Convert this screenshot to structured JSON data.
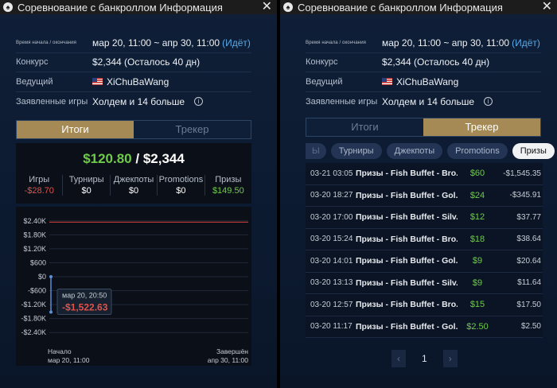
{
  "window_title": "Соревнование с банкроллом Информация",
  "info": {
    "time_label": "Время начала / окончания",
    "time_value": "мар 20, 11:00 ~ апр 30, 11:00",
    "time_status": "(Идёт)",
    "contest_label": "Конкурс",
    "contest_value": "$2,344 (Осталось 40 дн)",
    "host_label": "Ведущий",
    "host_value": "XiChuBaWang",
    "games_label": "Заявленные игры",
    "games_value": "Холдем и 14 больше"
  },
  "tabs": {
    "results": "Итоги",
    "tracker": "Трекер"
  },
  "summary": {
    "current": "$120.80",
    "separator": " / ",
    "target": "$2,344",
    "stats": [
      {
        "label": "Игры",
        "value": "-$28.70",
        "tone": "neg"
      },
      {
        "label": "Турниры",
        "value": "$0",
        "tone": ""
      },
      {
        "label": "Джекпоты",
        "value": "$0",
        "tone": ""
      },
      {
        "label": "Promotions",
        "value": "$0",
        "tone": ""
      },
      {
        "label": "Призы",
        "value": "$149.50",
        "tone": "pos"
      }
    ]
  },
  "chart_data": {
    "type": "line",
    "y_ticks": [
      "$2.40K",
      "$1.80K",
      "$1.20K",
      "$600",
      "$0",
      "-$600",
      "-$1.20K",
      "-$1.80K",
      "-$2.40K"
    ],
    "ylim": [
      -2700,
      2700
    ],
    "target_line": 2344,
    "series": [
      {
        "x": [
          "мар 20, 11:00",
          "мар 20, 20:50"
        ],
        "values": [
          0,
          -1522.63
        ]
      }
    ],
    "start_label": "Начало",
    "start_date": "мар 20, 11:00",
    "end_label": "Завершён",
    "end_date": "апр 30, 11:00",
    "tooltip": {
      "date": "мар 20, 20:50",
      "value": "-$1,522.63"
    },
    "colors": {
      "target": "#c23a3a",
      "line": "#5b8fd6",
      "grid": "#1f2838",
      "axis": "#c7cdd6"
    }
  },
  "filters": [
    "Ы",
    "Турниры",
    "Джекпоты",
    "Promotions",
    "Призы"
  ],
  "transactions": [
    {
      "date": "03-21 03:05",
      "desc": "Призы - Fish Buffet - Bro...",
      "amount": "$60",
      "balance": "-$1,545.35"
    },
    {
      "date": "03-20 18:27",
      "desc": "Призы - Fish Buffet - Gol...",
      "amount": "$24",
      "balance": "-$345.91"
    },
    {
      "date": "03-20 17:00",
      "desc": "Призы - Fish Buffet - Silv...",
      "amount": "$12",
      "balance": "$37.77"
    },
    {
      "date": "03-20 15:24",
      "desc": "Призы - Fish Buffet - Bro...",
      "amount": "$18",
      "balance": "$38.64"
    },
    {
      "date": "03-20 14:01",
      "desc": "Призы - Fish Buffet - Gol...",
      "amount": "$9",
      "balance": "$20.64"
    },
    {
      "date": "03-20 13:13",
      "desc": "Призы - Fish Buffet - Silv...",
      "amount": "$9",
      "balance": "$11.64"
    },
    {
      "date": "03-20 12:57",
      "desc": "Призы - Fish Buffet - Bro...",
      "amount": "$15",
      "balance": "$17.50"
    },
    {
      "date": "03-20 11:17",
      "desc": "Призы - Fish Buffet - Gol...",
      "amount": "$2.50",
      "balance": "$2.50"
    }
  ],
  "pager": {
    "prev": "‹",
    "page": "1",
    "next": "›"
  },
  "icons": {
    "logo": "♠",
    "close": "✕",
    "info": "i"
  }
}
